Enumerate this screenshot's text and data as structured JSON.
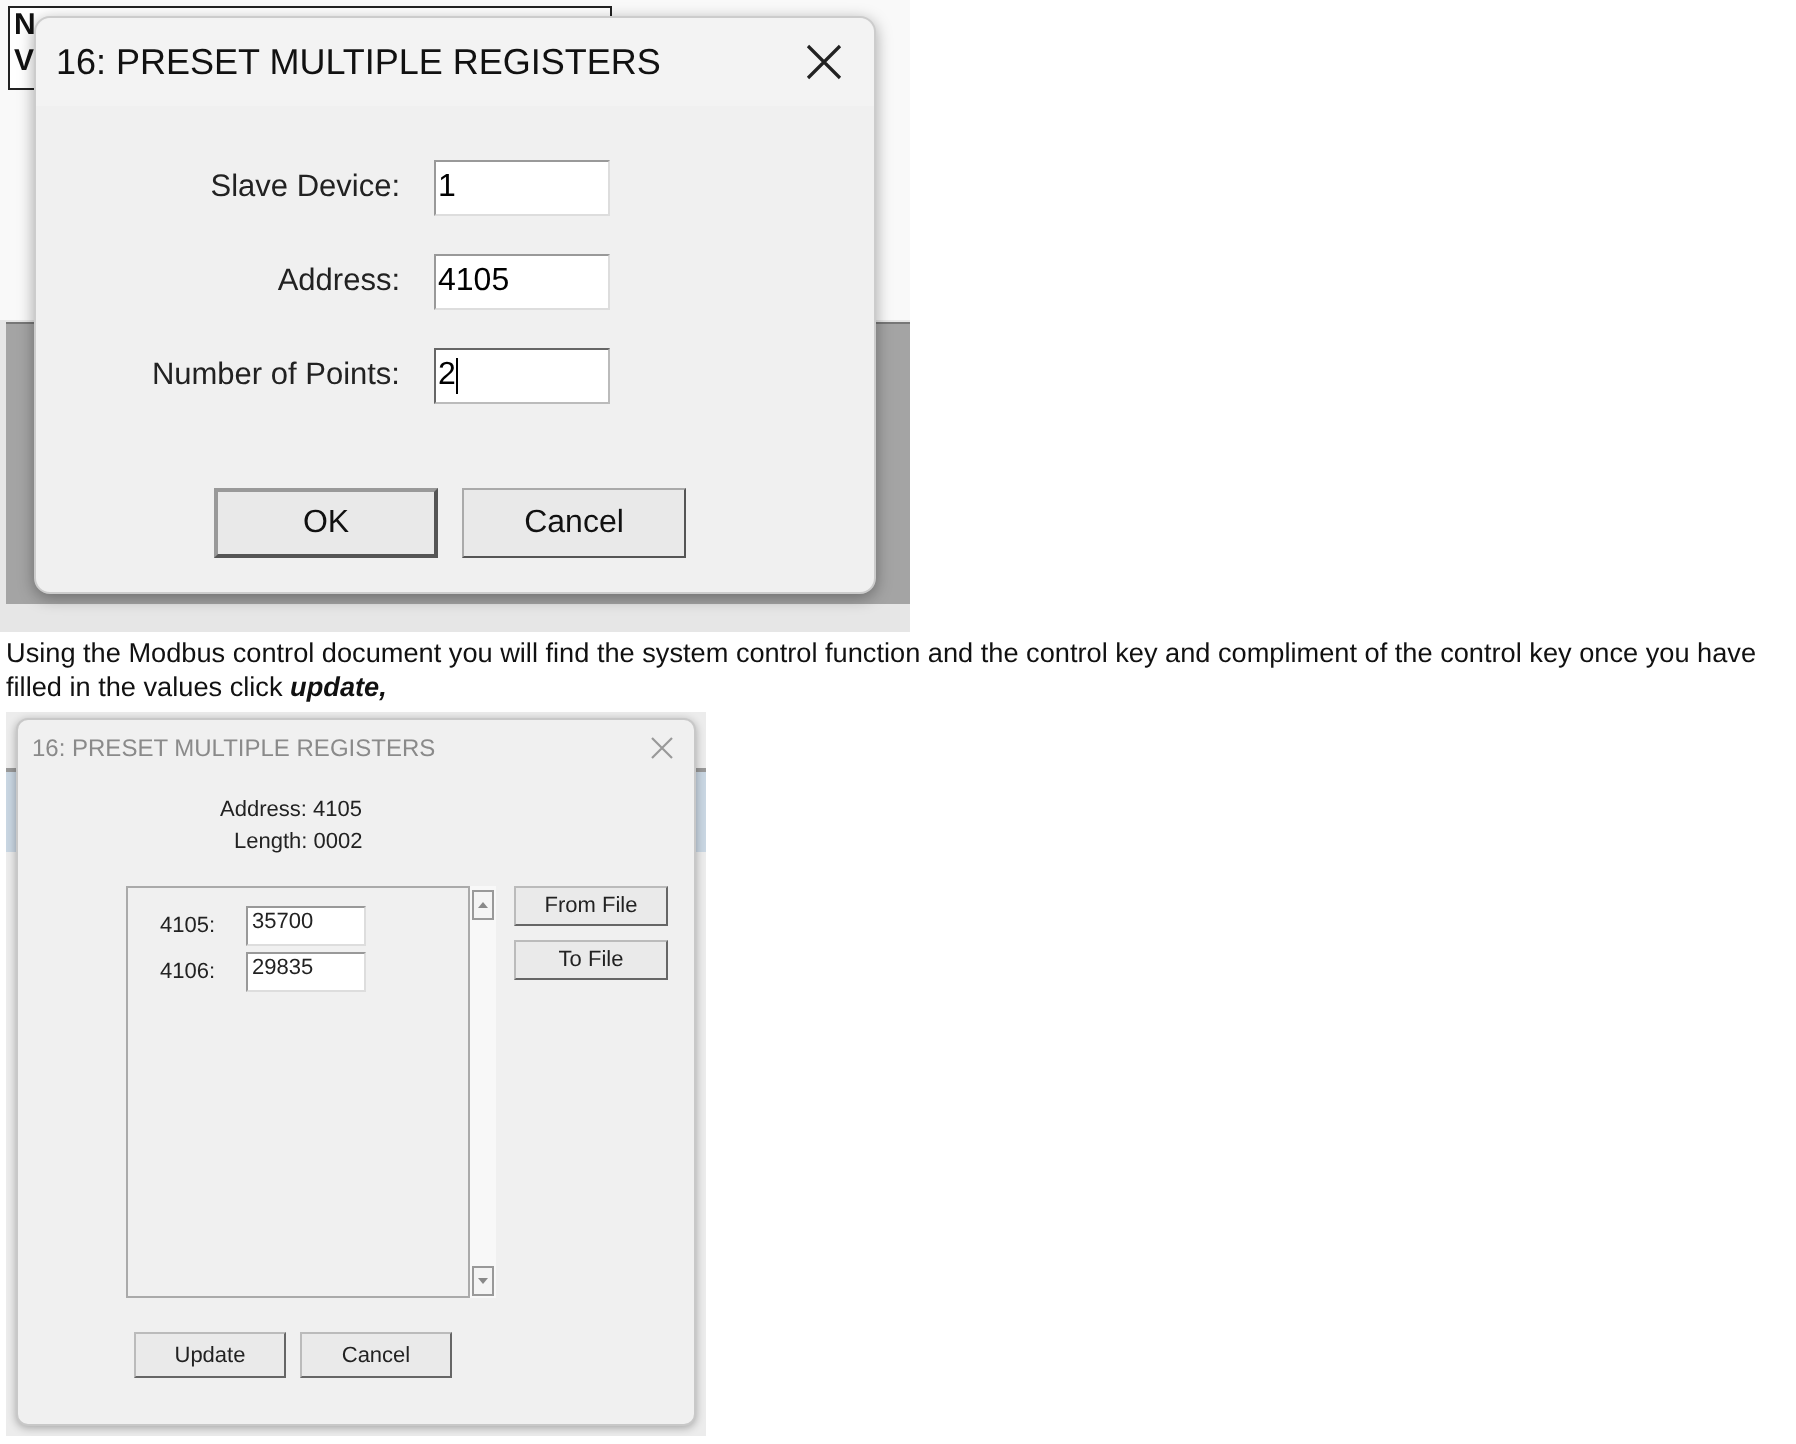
{
  "first_screenshot": {
    "background_window": {
      "lines": [
        "N",
        "V"
      ]
    },
    "dialog": {
      "title": "16: PRESET MULTIPLE REGISTERS",
      "active": true,
      "fields": [
        {
          "label": "Slave Device:",
          "value": "1",
          "focused": false
        },
        {
          "label": "Address:",
          "value": "4105",
          "focused": false
        },
        {
          "label": "Number of Points:",
          "value": "2",
          "focused": true
        }
      ],
      "buttons": [
        {
          "label": "OK",
          "default": true
        },
        {
          "label": "Cancel",
          "default": false
        }
      ]
    }
  },
  "instruction": {
    "text": "Using the Modbus control document you will find the system control function and the control key and compliment of the control key once you have filled in the values click **update,**"
  },
  "second_screenshot": {
    "dialog": {
      "title": "16: PRESET MULTIPLE REGISTERS",
      "active": false,
      "address": "Address: 4105",
      "length": "Length: 0002",
      "registers": [
        {
          "label": "4105:",
          "value": "35700"
        },
        {
          "label": "4106:",
          "value": "29835"
        }
      ],
      "side_buttons": [
        "From File",
        "To File"
      ],
      "buttons": [
        "Update",
        "Cancel"
      ]
    }
  }
}
